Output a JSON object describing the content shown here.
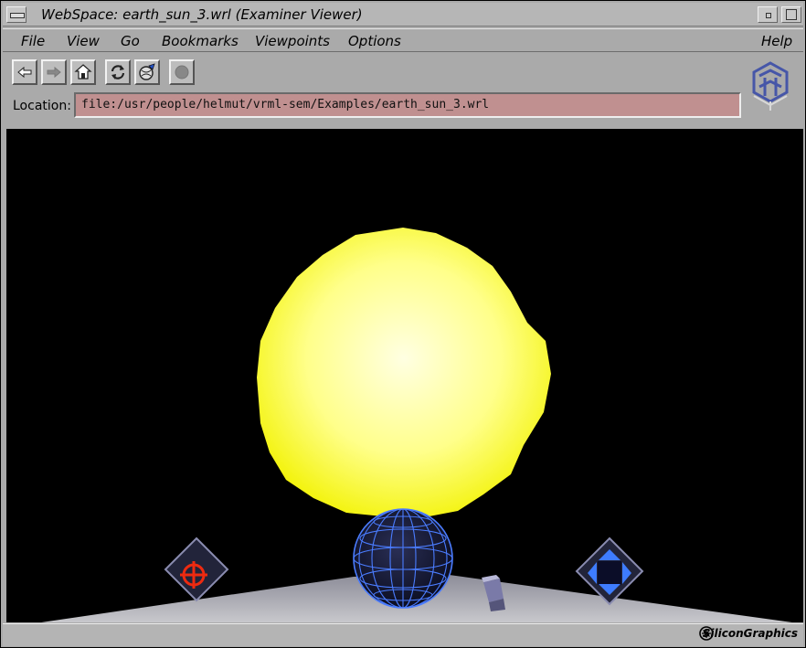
{
  "window": {
    "title": "WebSpace: earth_sun_3.wrl (Examiner Viewer)"
  },
  "menubar": {
    "items": [
      "File",
      "View",
      "Go",
      "Bookmarks",
      "Viewpoints",
      "Options"
    ],
    "help": "Help"
  },
  "toolbar": {
    "buttons": [
      "back-icon",
      "forward-icon",
      "home-icon",
      "reload-icon",
      "open-world-icon",
      "stop-icon"
    ]
  },
  "location": {
    "label": "Location:",
    "value": "file:/usr/people/helmut/vrml-sem/Examples/earth_sun_3.wrl"
  },
  "statusbar": {
    "brand": "SiliconGraphics"
  },
  "colors": {
    "location_field": "#c09090",
    "sun": "#ffff44",
    "viewer_background": "#000000",
    "earth_wireframe": "#4a7cff"
  }
}
